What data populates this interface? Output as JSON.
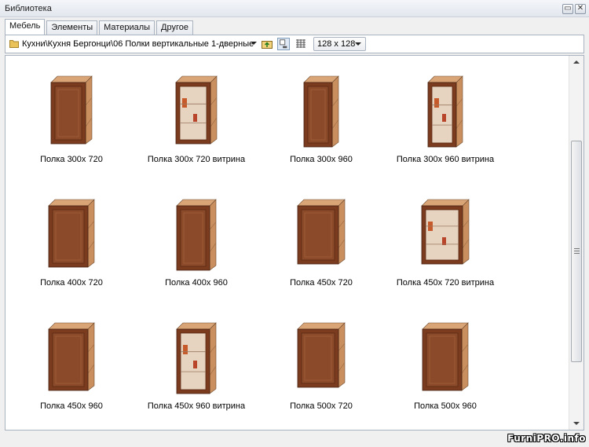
{
  "window": {
    "title": "Библиотека"
  },
  "tabs": [
    {
      "label": "Мебель",
      "active": true
    },
    {
      "label": "Элементы",
      "active": false
    },
    {
      "label": "Материалы",
      "active": false
    },
    {
      "label": "Другое",
      "active": false
    }
  ],
  "toolbar": {
    "path": "Кухни\\Кухня Бергонци\\06 Полки вертикальные 1-дверные",
    "thumb_size": "128 x 128"
  },
  "items": [
    {
      "label": "Полка 300х 720",
      "style": "narrow",
      "vitrina": false
    },
    {
      "label": "Полка 300х 720 витрина",
      "style": "narrow",
      "vitrina": true
    },
    {
      "label": "Полка 300х 960",
      "style": "tall-narrow",
      "vitrina": false
    },
    {
      "label": "Полка 300х 960 витрина",
      "style": "tall-narrow",
      "vitrina": true
    },
    {
      "label": "Полка 400х 720",
      "style": "medium",
      "vitrina": false
    },
    {
      "label": "Полка 400х 960",
      "style": "tall-medium",
      "vitrina": false
    },
    {
      "label": "Полка 450х 720",
      "style": "wide",
      "vitrina": false
    },
    {
      "label": "Полка 450х 720 витрина",
      "style": "wide",
      "vitrina": true
    },
    {
      "label": "Полка 450х 960",
      "style": "medium",
      "vitrina": false
    },
    {
      "label": "Полка 450х 960 витрина",
      "style": "tall-medium",
      "vitrina": true
    },
    {
      "label": "Полка 500х 720",
      "style": "wide",
      "vitrina": false
    },
    {
      "label": "Полка 500х 960",
      "style": "medium",
      "vitrina": false
    }
  ],
  "watermark": "FurniPRO.info",
  "colors": {
    "cabinet_side": "#c98f5f",
    "cabinet_top": "#d9a577",
    "door_frame": "#7a3b1f",
    "door_panel": "#8b4a2a",
    "glass": "#e6d3c0"
  }
}
